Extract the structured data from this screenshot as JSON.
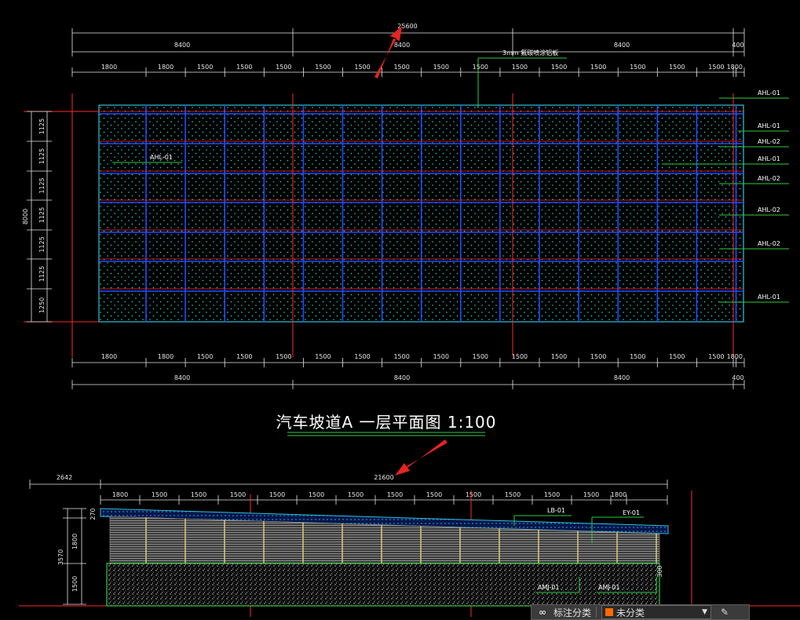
{
  "plan": {
    "top_total_dim": "25600",
    "top_segment_dims": [
      "8400",
      "8400",
      "8400",
      "400"
    ],
    "top_bay_dims": [
      "1800",
      "1800",
      "1500",
      "1500",
      "1500",
      "1500",
      "1500",
      "1500",
      "1500",
      "1500",
      "1500",
      "1500",
      "1500",
      "1500",
      "1500",
      "1500",
      "1800"
    ],
    "panel_note": "3mm 氟碳喷涂铝板",
    "left_row_dims": [
      "1125",
      "1125",
      "1125",
      "1125",
      "1125",
      "1125",
      "1250"
    ],
    "left_total_dim": "8000",
    "bottom_bay_dims": [
      "1800",
      "1800",
      "1500",
      "1500",
      "1500",
      "1500",
      "1500",
      "1500",
      "1500",
      "1500",
      "1500",
      "1500",
      "1500",
      "1500",
      "1500",
      "1500",
      "1800"
    ],
    "bottom_segment_dims": [
      "8400",
      "8400",
      "8400",
      "400"
    ],
    "callouts": [
      "AHL-01",
      "AHL-01",
      "AHL-02",
      "AHL-01",
      "AHL-02",
      "AHL-02",
      "AHL-02",
      "AHL-01"
    ],
    "inner_callout": "AHL-01",
    "title": "汽车坡道A 一层平面图 1:100"
  },
  "elevation": {
    "left_offset_dim": "2642",
    "total_dim": "21600",
    "bay_dims": [
      "1800",
      "1500",
      "1500",
      "1500",
      "1500",
      "1500",
      "1500",
      "1500",
      "1500",
      "1500",
      "1500",
      "1500",
      "1500",
      "1800"
    ],
    "height_total": "3570",
    "height_dims": [
      "270",
      "1800",
      "1500"
    ],
    "labels": {
      "lb": "LB-01",
      "ey": "EY-01",
      "amj1": "AMJ-01",
      "amj2": "AMJ-01",
      "side": "300"
    }
  },
  "toolbar": {
    "link_icon": "link-icon",
    "label": "标注分类",
    "select_value": "未分类",
    "accent": "#ff6a00"
  },
  "colors": {
    "grid": "#1e4dff",
    "frame": "#34c0d8",
    "red": "#ff2a2a",
    "green": "#2ecc40"
  }
}
